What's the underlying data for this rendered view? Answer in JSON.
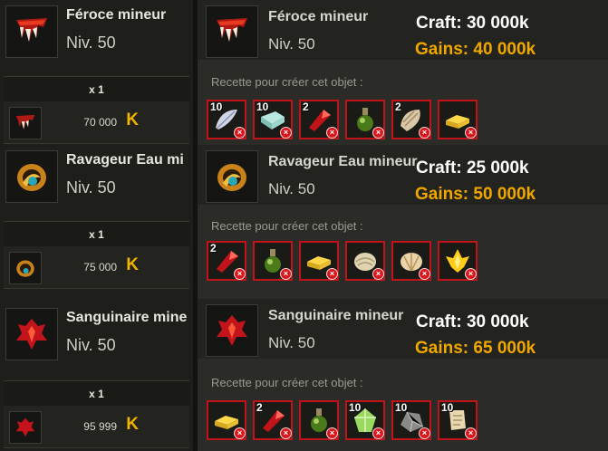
{
  "left_panel": {
    "items": [
      {
        "name": "Féroce mineur",
        "level": "Niv. 50",
        "icon": "fang-icon",
        "quantity": "x 1",
        "price": "70 000",
        "currency_symbol": "K"
      },
      {
        "name": "Ravageur Eau mi",
        "level": "Niv. 50",
        "icon": "water-amulet-icon",
        "quantity": "x 1",
        "price": "75 000",
        "currency_symbol": "K"
      },
      {
        "name": "Sanguinaire mine",
        "level": "Niv. 50",
        "icon": "blood-crest-icon",
        "quantity": "x 1",
        "price": "95 999",
        "currency_symbol": "K"
      }
    ]
  },
  "right_panel": {
    "recipe_label": "Recette pour créer cet objet :",
    "items": [
      {
        "name": "Féroce mineur",
        "level": "Niv. 50",
        "icon": "fang-icon",
        "craft": "Craft: 30 000k",
        "gains": "Gains: 40 000k",
        "ingredients": [
          {
            "icon": "feather-icon",
            "qty": "10"
          },
          {
            "icon": "crystal-icon",
            "qty": "10"
          },
          {
            "icon": "red-shard-icon",
            "qty": "2"
          },
          {
            "icon": "potion-icon",
            "qty": ""
          },
          {
            "icon": "shell-icon",
            "qty": "2"
          },
          {
            "icon": "gold-bar-icon",
            "qty": ""
          }
        ]
      },
      {
        "name": "Ravageur Eau mineur",
        "level": "Niv. 50",
        "icon": "water-amulet-icon",
        "craft": "Craft: 25 000k",
        "gains": "Gains: 50 000k",
        "ingredients": [
          {
            "icon": "red-shard-icon",
            "qty": "2"
          },
          {
            "icon": "potion-icon",
            "qty": ""
          },
          {
            "icon": "gold-bar-icon",
            "qty": ""
          },
          {
            "icon": "shell-icon",
            "qty": ""
          },
          {
            "icon": "shell-icon",
            "qty": ""
          },
          {
            "icon": "gold-gem-icon",
            "qty": ""
          }
        ]
      },
      {
        "name": "Sanguinaire mineur",
        "level": "Niv. 50",
        "icon": "blood-crest-icon",
        "craft": "Craft: 30 000k",
        "gains": "Gains: 65 000k",
        "ingredients": [
          {
            "icon": "gold-bar-icon",
            "qty": ""
          },
          {
            "icon": "red-shard-icon",
            "qty": "2"
          },
          {
            "icon": "potion-icon",
            "qty": ""
          },
          {
            "icon": "green-crystal-icon",
            "qty": "10"
          },
          {
            "icon": "stone-icon",
            "qty": "10"
          },
          {
            "icon": "scroll-icon",
            "qty": "10"
          }
        ]
      }
    ]
  },
  "colors": {
    "gains": "#f0a800",
    "craft": "#ffffff",
    "missing_border": "#c0141a",
    "kama": "#f0b400"
  }
}
